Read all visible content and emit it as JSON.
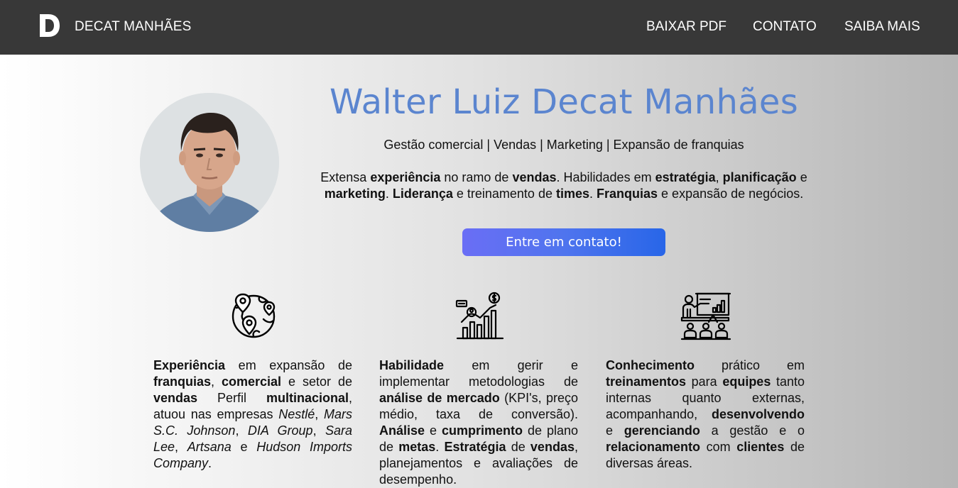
{
  "header": {
    "logo_letter": "D",
    "brand": "DECAT MANHÃES",
    "nav": {
      "pdf": "BAIXAR PDF",
      "contato": "CONTATO",
      "saiba": "SAIBA MAIS"
    }
  },
  "hero": {
    "name": "Walter Luiz Decat Manhães",
    "tagline": "Gestão comercial | Vendas | Marketing | Expansão de franquias",
    "summary": [
      {
        "t": "Extensa "
      },
      {
        "t": "experiência",
        "b": true
      },
      {
        "t": " no ramo de "
      },
      {
        "t": "vendas",
        "b": true
      },
      {
        "t": ". Habilidades em "
      },
      {
        "t": "estratégia",
        "b": true
      },
      {
        "t": ", "
      },
      {
        "t": "planificação",
        "b": true
      },
      {
        "t": " e "
      },
      {
        "t": "marketing",
        "b": true
      },
      {
        "t": ". "
      },
      {
        "t": "Liderança",
        "b": true
      },
      {
        "t": " e treinamento de "
      },
      {
        "t": "times",
        "b": true
      },
      {
        "t": ". "
      },
      {
        "t": "Franquias",
        "b": true
      },
      {
        "t": " e expansão de negócios."
      }
    ],
    "cta": "Entre em contato!"
  },
  "features": [
    {
      "icon": "globe-pins-icon",
      "text": [
        {
          "t": "Experiência",
          "b": true
        },
        {
          "t": " em expansão de "
        },
        {
          "t": "franquias",
          "b": true
        },
        {
          "t": ", "
        },
        {
          "t": "comercial",
          "b": true
        },
        {
          "t": " e setor de "
        },
        {
          "t": "vendas",
          "b": true
        },
        {
          "t": " Perfil "
        },
        {
          "t": "multinacional",
          "b": true
        },
        {
          "t": ", atuou nas empresas "
        },
        {
          "t": "Nestlé",
          "i": true
        },
        {
          "t": ", "
        },
        {
          "t": "Mars S.C. Johnson",
          "i": true
        },
        {
          "t": ", "
        },
        {
          "t": "DIA Group",
          "i": true
        },
        {
          "t": ", "
        },
        {
          "t": "Sara Lee",
          "i": true
        },
        {
          "t": ", "
        },
        {
          "t": "Artsana",
          "i": true
        },
        {
          "t": " e "
        },
        {
          "t": "Hudson Imports Company",
          "i": true
        },
        {
          "t": "."
        }
      ]
    },
    {
      "icon": "market-analysis-icon",
      "text": [
        {
          "t": "Habilidade",
          "b": true
        },
        {
          "t": " em gerir e implementar metodologias de "
        },
        {
          "t": "análise de mercado",
          "b": true
        },
        {
          "t": " (KPI's, preço médio, taxa de conversão). "
        },
        {
          "t": "Análise",
          "b": true
        },
        {
          "t": " e "
        },
        {
          "t": "cumprimento",
          "b": true
        },
        {
          "t": " de plano de "
        },
        {
          "t": "metas",
          "b": true
        },
        {
          "t": ". "
        },
        {
          "t": "Estratégia",
          "b": true
        },
        {
          "t": " de "
        },
        {
          "t": "vendas",
          "b": true
        },
        {
          "t": ", planejamentos e avaliações de desempenho."
        }
      ]
    },
    {
      "icon": "training-presentation-icon",
      "text": [
        {
          "t": "Conhecimento",
          "b": true
        },
        {
          "t": " prático em "
        },
        {
          "t": "treinamentos",
          "b": true
        },
        {
          "t": " para "
        },
        {
          "t": "equipes",
          "b": true
        },
        {
          "t": " tanto internas quanto externas, acompanhando, "
        },
        {
          "t": "desenvolvendo",
          "b": true
        },
        {
          "t": " e "
        },
        {
          "t": "gerenciando",
          "b": true
        },
        {
          "t": " a gestão e o "
        },
        {
          "t": "relacionamento",
          "b": true
        },
        {
          "t": " com "
        },
        {
          "t": "clientes",
          "b": true
        },
        {
          "t": " de diversas áreas."
        }
      ]
    }
  ]
}
